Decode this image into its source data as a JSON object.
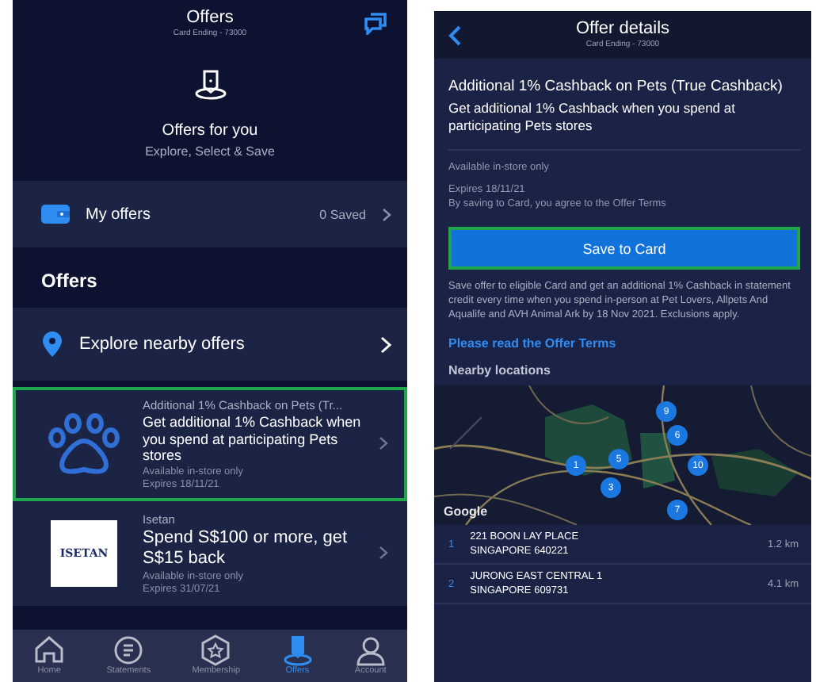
{
  "offers_screen": {
    "title": "Offers",
    "subtitle": "Card Ending - 73000",
    "hero": {
      "title": "Offers for you",
      "subtitle": "Explore, Select & Save"
    },
    "my_offers": {
      "label": "My offers",
      "count": "0 Saved"
    },
    "section_title": "Offers",
    "explore": {
      "label": "Explore nearby offers"
    },
    "offers": [
      {
        "kind": "paw",
        "selected": true,
        "merchant": "Additional 1% Cashback on Pets (Tr...",
        "headline": "Get additional 1% Cashback when you spend at participating Pets stores",
        "availability": "Available in-store only",
        "expiry": "Expires 18/11/21"
      },
      {
        "kind": "logo",
        "selected": false,
        "merchant": "Isetan",
        "logo_text": "ISETAN",
        "headline": "Spend S$100 or more, get S$15 back",
        "availability": "Available in-store only",
        "expiry": "Expires 31/07/21"
      }
    ],
    "tab_bar": [
      {
        "kind": "home",
        "label": "Home",
        "selected": false
      },
      {
        "kind": "statements",
        "label": "Statements",
        "selected": false
      },
      {
        "kind": "membership",
        "label": "Membership",
        "selected": false
      },
      {
        "kind": "offers",
        "label": "Offers",
        "selected": true
      },
      {
        "kind": "account",
        "label": "Account",
        "selected": false
      }
    ]
  },
  "details_screen": {
    "title": "Offer details",
    "subtitle": "Card Ending - 73000",
    "offer_title": "Additional 1% Cashback on Pets (True Cashback)",
    "offer_headline": "Get additional 1% Cashback when you spend at participating Pets stores",
    "availability": "Available in-store only",
    "expiry": "Expires 18/11/21",
    "agreement": "By saving to Card, you agree to the Offer Terms",
    "save_button": {
      "label": "Save to Card",
      "highlighted": true
    },
    "description": "Save offer to eligible Card and get an additional 1% Cashback in statement credit every time when you spend in-person at Pet Lovers, Allpets And Aqualife and AVH Animal Ark by 18 Nov 2021. Exclusions apply.",
    "terms_link": "Please read the Offer Terms",
    "nearby_title": "Nearby locations",
    "map": {
      "attribution": "Google",
      "pins": [
        "9",
        "6",
        "1",
        "5",
        "10",
        "3",
        "7"
      ]
    },
    "locations": [
      {
        "number": "1",
        "line1": "221 BOON LAY PLACE",
        "line2": "SINGAPORE 640221",
        "distance": "1.2 km"
      },
      {
        "number": "2",
        "line1": "JURONG EAST CENTRAL 1",
        "line2": "SINGAPORE 609731",
        "distance": "4.1 km"
      }
    ]
  }
}
